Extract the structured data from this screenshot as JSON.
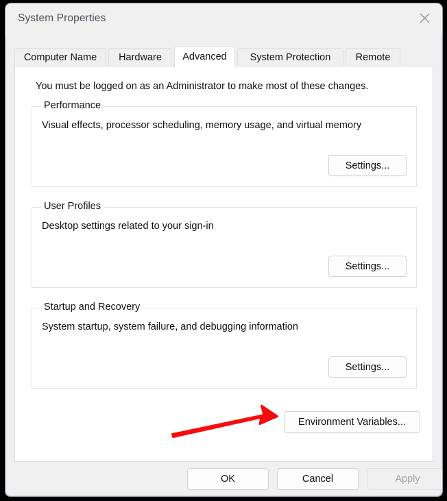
{
  "window": {
    "title": "System Properties",
    "close_icon": "close-icon"
  },
  "tabs": [
    {
      "label": "Computer Name",
      "selected": false
    },
    {
      "label": "Hardware",
      "selected": false
    },
    {
      "label": "Advanced",
      "selected": true
    },
    {
      "label": "System Protection",
      "selected": false
    },
    {
      "label": "Remote",
      "selected": false
    }
  ],
  "panel": {
    "admin_note": "You must be logged on as an Administrator to make most of these changes.",
    "groups": [
      {
        "legend": "Performance",
        "description": "Visual effects, processor scheduling, memory usage, and virtual memory",
        "button": "Settings..."
      },
      {
        "legend": "User Profiles",
        "description": "Desktop settings related to your sign-in",
        "button": "Settings..."
      },
      {
        "legend": "Startup and Recovery",
        "description": "System startup, system failure, and debugging information",
        "button": "Settings..."
      }
    ],
    "environment_variables_button": "Environment Variables..."
  },
  "footer": {
    "ok": "OK",
    "cancel": "Cancel",
    "apply": "Apply"
  },
  "annotation": {
    "arrow_color": "#f50d0d",
    "arrow_points_to": "Environment Variables..."
  }
}
